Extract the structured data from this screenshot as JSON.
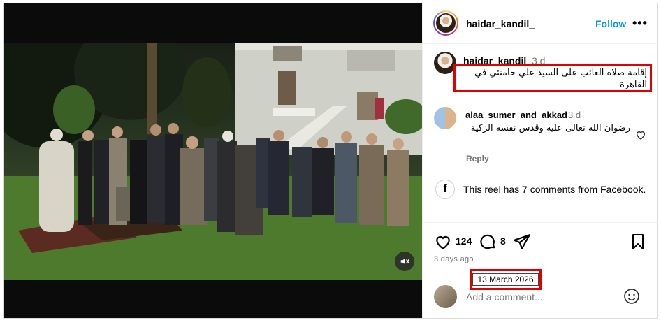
{
  "post": {
    "username": "haidar_kandil_",
    "follow_label": "Follow",
    "more_label": "•••"
  },
  "caption": {
    "username": "haidar_kandil_",
    "time": "3 d",
    "text": "إقامة صلاة الغائب على السيد علي خامنئي في القاهرة"
  },
  "comment": {
    "username": "alaa_sumer_and_akkad",
    "time": "3 d",
    "text": "رضوان الله تعالى عليه وقدس نفسه الزكية",
    "reply_label": "Reply"
  },
  "facebook_note": {
    "icon": "f",
    "text": "This reel has 7 comments from Facebook."
  },
  "actions": {
    "likes": "124",
    "comments": "8"
  },
  "posted_ago": "3 days ago",
  "annotation_date": "13 March 2026",
  "add_comment": {
    "placeholder": "Add a comment..."
  },
  "colors": {
    "accent": "#0095f6",
    "highlight": "#e00000"
  },
  "icons": [
    "mute-icon",
    "heart-icon",
    "comment-icon",
    "share-icon",
    "bookmark-icon",
    "emoji-icon",
    "facebook-icon"
  ]
}
